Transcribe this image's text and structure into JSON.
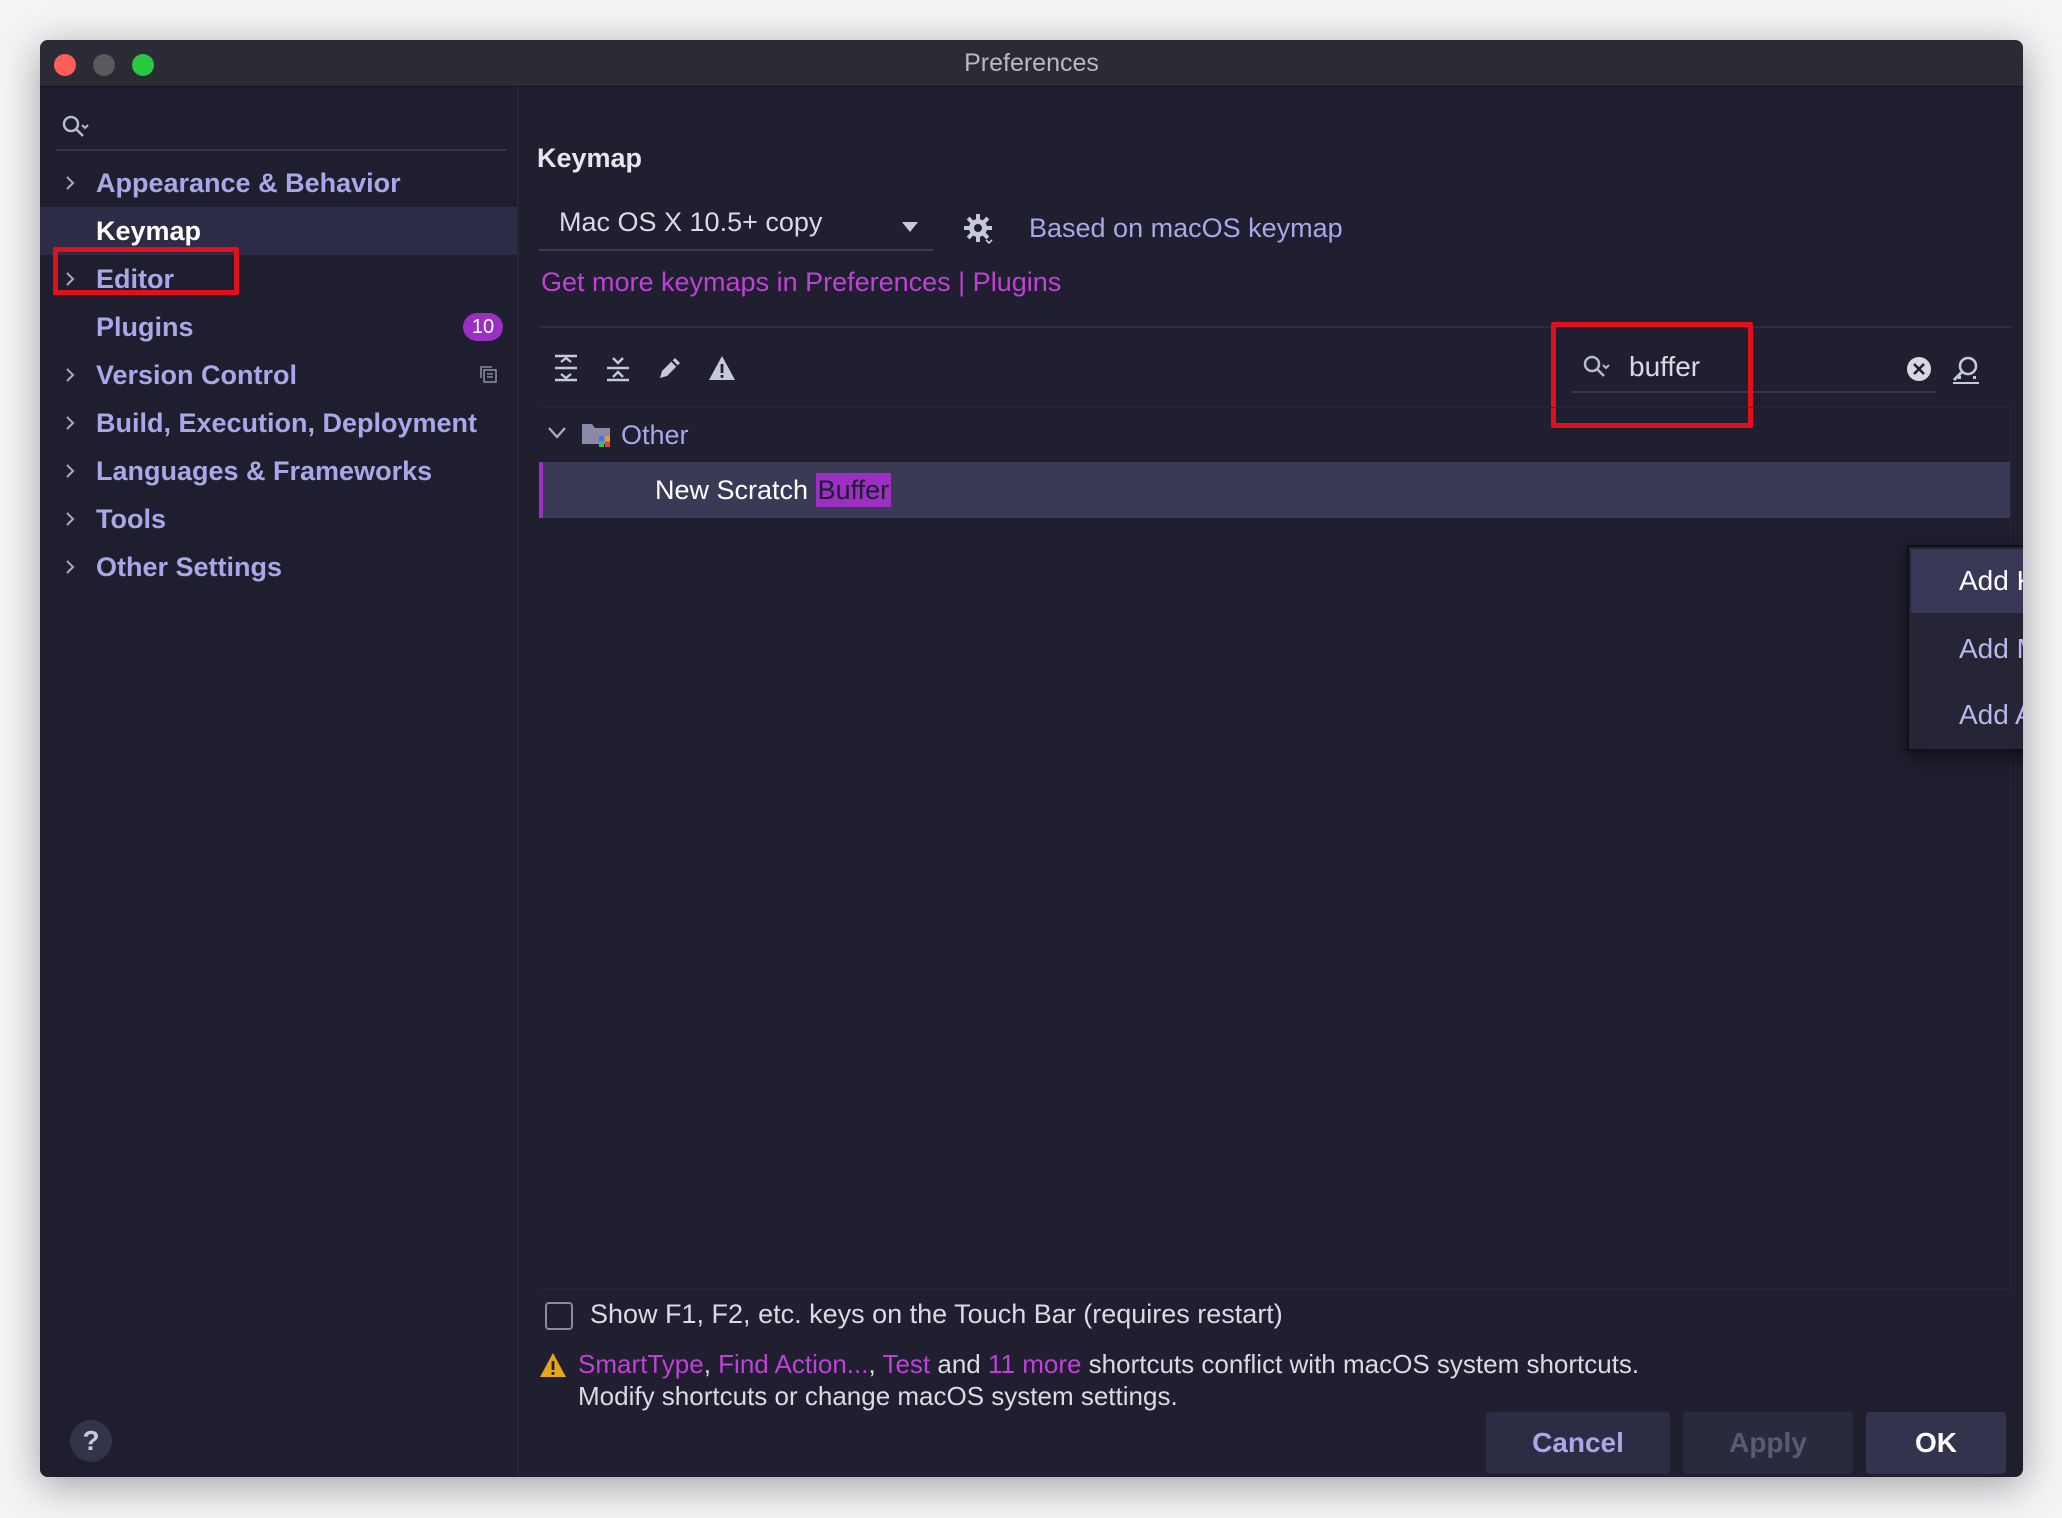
{
  "window": {
    "title": "Preferences"
  },
  "sidebar": {
    "search_placeholder": "",
    "items": [
      {
        "label": "Appearance & Behavior",
        "expandable": true
      },
      {
        "label": "Keymap",
        "expandable": false,
        "selected": true
      },
      {
        "label": "Editor",
        "expandable": true
      },
      {
        "label": "Plugins",
        "expandable": false,
        "badge": "10"
      },
      {
        "label": "Version Control",
        "expandable": true
      },
      {
        "label": "Build, Execution, Deployment",
        "expandable": true
      },
      {
        "label": "Languages & Frameworks",
        "expandable": true
      },
      {
        "label": "Tools",
        "expandable": true
      },
      {
        "label": "Other Settings",
        "expandable": true
      }
    ]
  },
  "main": {
    "heading": "Keymap",
    "keymap_select": "Mac OS X 10.5+ copy",
    "based_on": "Based on macOS keymap",
    "more_keymaps_link": "Get more keymaps in Preferences | Plugins",
    "search_value": "buffer",
    "tree": {
      "group": "Other",
      "row_prefix": "New Scratch ",
      "row_match": "Buffer"
    },
    "context_menu": [
      "Add Keyboard Shortcut",
      "Add Mouse Shortcut",
      "Add Abbreviation"
    ],
    "touchbar_checkbox": "Show F1, F2, etc. keys on the Touch Bar (requires restart)",
    "warning": {
      "link1": "SmartType",
      "sep1": ", ",
      "link2": "Find Action...",
      "sep2": ", ",
      "link3": "Test",
      "and": " and ",
      "link4": "11 more",
      "rest": " shortcuts conflict with macOS system shortcuts.",
      "line2": "Modify shortcuts or change macOS system settings."
    }
  },
  "footer": {
    "help": "?",
    "cancel": "Cancel",
    "apply": "Apply",
    "ok": "OK"
  },
  "colors": {
    "accent": "#9a2fc2",
    "link": "#c040d8",
    "highlight_box": "#e0101c"
  }
}
